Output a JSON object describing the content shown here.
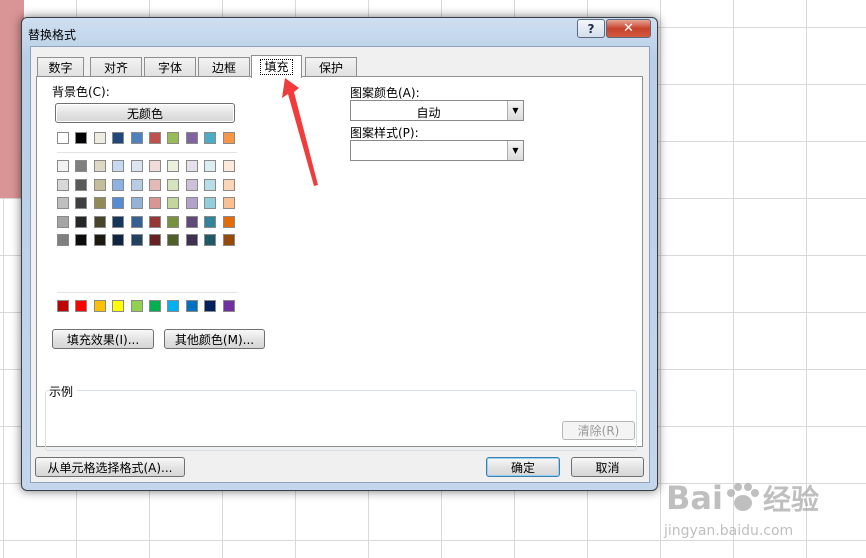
{
  "dialog": {
    "title": "替换格式",
    "help_label": "?",
    "close_label": "✕",
    "tabs": [
      {
        "label": "数字"
      },
      {
        "label": "对齐"
      },
      {
        "label": "字体"
      },
      {
        "label": "边框"
      },
      {
        "label": "填充",
        "active": true
      },
      {
        "label": "保护"
      }
    ],
    "fill": {
      "background_label": "背景色(C):",
      "no_color_label": "无颜色",
      "theme_row": [
        "#ffffff",
        "#000000",
        "#eeece1",
        "#1f497d",
        "#4f81bd",
        "#c0504d",
        "#9bbb59",
        "#8064a2",
        "#4bacc6",
        "#f79646"
      ],
      "tint_rows": [
        [
          "#f2f2f2",
          "#7f7f7f",
          "#ddd9c3",
          "#c6d9f0",
          "#dbe5f1",
          "#f2dcdb",
          "#ebf1dd",
          "#e5e0ec",
          "#dbeef3",
          "#fdeada"
        ],
        [
          "#d8d8d8",
          "#595959",
          "#c4bd97",
          "#8db3e2",
          "#b8cce4",
          "#e5b9b7",
          "#d7e3bc",
          "#ccc1d9",
          "#b7dde8",
          "#fbd5b5"
        ],
        [
          "#bfbfbf",
          "#3f3f3f",
          "#938953",
          "#548dd4",
          "#95b3d7",
          "#d99694",
          "#c3d69b",
          "#b2a2c7",
          "#92cddc",
          "#fac08f"
        ],
        [
          "#a5a5a5",
          "#262626",
          "#494429",
          "#17365d",
          "#366092",
          "#953734",
          "#76923c",
          "#5f497a",
          "#31859b",
          "#e36c09"
        ],
        [
          "#7f7f7f",
          "#0c0c0c",
          "#1d1b10",
          "#0f243e",
          "#244061",
          "#632423",
          "#4f6128",
          "#3f3151",
          "#205867",
          "#974806"
        ]
      ],
      "standard_row": [
        "#c00000",
        "#ff0000",
        "#ffc000",
        "#ffff00",
        "#92d050",
        "#00b050",
        "#00b0f0",
        "#0070c0",
        "#002060",
        "#7030a0"
      ],
      "fill_effects_label": "填充效果(I)...",
      "more_colors_label": "其他颜色(M)...",
      "pattern_color_label": "图案颜色(A):",
      "pattern_color_value": "自动",
      "pattern_style_label": "图案样式(P):",
      "pattern_style_value": "",
      "sample_label": "示例",
      "clear_label": "清除(R)"
    },
    "choose_from_cell_label": "从单元格选择格式(A)...",
    "ok_label": "确定",
    "cancel_label": "取消"
  },
  "annotation": {
    "arrow_color": "#f03c3c"
  },
  "watermark": {
    "brand": "Bai",
    "brand_cn": "经验",
    "url": "jingyan.baidu.com"
  }
}
